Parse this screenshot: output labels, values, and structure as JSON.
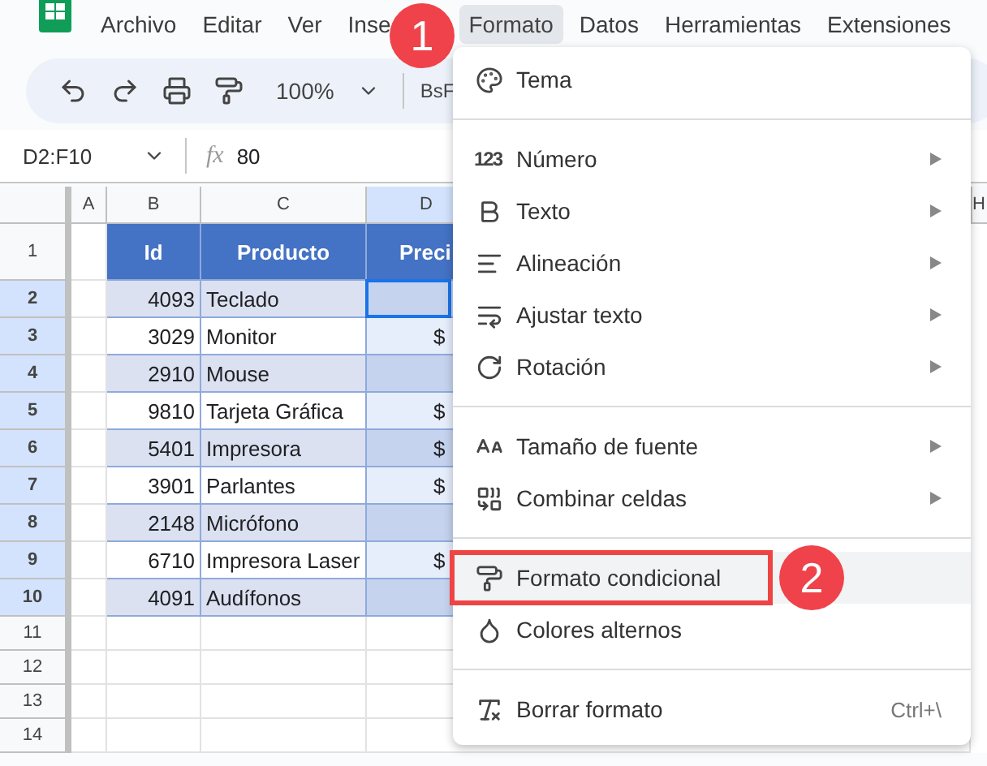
{
  "app_menu": [
    {
      "label": "Archivo",
      "selected": false
    },
    {
      "label": "Editar",
      "selected": false
    },
    {
      "label": "Ver",
      "selected": false
    },
    {
      "label": "Inse",
      "selected": false
    },
    {
      "label": "Formato",
      "selected": true
    },
    {
      "label": "Datos",
      "selected": false
    },
    {
      "label": "Herramientas",
      "selected": false
    },
    {
      "label": "Extensiones",
      "selected": false
    }
  ],
  "toolbar": {
    "zoom": "100%",
    "font": "BsF"
  },
  "formula_bar": {
    "range": "D2:F10",
    "function_label": "fx",
    "value": "80"
  },
  "grid": {
    "columns": [
      {
        "label": "A",
        "selected": false
      },
      {
        "label": "B",
        "selected": false
      },
      {
        "label": "C",
        "selected": false
      },
      {
        "label": "D",
        "selected": true
      },
      {
        "label": "H",
        "selected": false
      }
    ],
    "rows": [
      {
        "number": "1",
        "selected": false,
        "active": false,
        "kind": "header",
        "cells": [
          "Id",
          "Producto",
          "Preci"
        ]
      },
      {
        "number": "2",
        "selected": true,
        "active": true,
        "kind": "data",
        "cells": [
          "4093",
          "Teclado"
        ]
      },
      {
        "number": "3",
        "selected": true,
        "active": false,
        "kind": "data",
        "cells": [
          "3029",
          "Monitor",
          "$"
        ]
      },
      {
        "number": "4",
        "selected": true,
        "active": false,
        "kind": "data",
        "cells": [
          "2910",
          "Mouse"
        ]
      },
      {
        "number": "5",
        "selected": true,
        "active": false,
        "kind": "data",
        "cells": [
          "9810",
          "Tarjeta Gráfica",
          "$"
        ]
      },
      {
        "number": "6",
        "selected": true,
        "active": false,
        "kind": "data",
        "cells": [
          "5401",
          "Impresora",
          "$"
        ]
      },
      {
        "number": "7",
        "selected": true,
        "active": false,
        "kind": "data",
        "cells": [
          "3901",
          "Parlantes",
          "$"
        ]
      },
      {
        "number": "8",
        "selected": true,
        "active": false,
        "kind": "data",
        "cells": [
          "2148",
          "Micrófono"
        ]
      },
      {
        "number": "9",
        "selected": true,
        "active": false,
        "kind": "data",
        "cells": [
          "6710",
          "Impresora Laser",
          "$"
        ]
      },
      {
        "number": "10",
        "selected": true,
        "active": false,
        "kind": "data",
        "cells": [
          "4091",
          "Audífonos"
        ]
      },
      {
        "number": "11",
        "selected": false,
        "active": false,
        "kind": "empty"
      },
      {
        "number": "12",
        "selected": false,
        "active": false,
        "kind": "empty"
      },
      {
        "number": "13",
        "selected": false,
        "active": false,
        "kind": "empty"
      },
      {
        "number": "14",
        "selected": false,
        "active": false,
        "kind": "empty"
      }
    ]
  },
  "format_menu": {
    "items": [
      {
        "kind": "item",
        "label": "Tema",
        "submenu": false,
        "highlighted": false
      },
      {
        "kind": "divider"
      },
      {
        "kind": "item",
        "glyph": "123",
        "label": "Número",
        "submenu": true,
        "highlighted": false
      },
      {
        "kind": "item",
        "label": "Texto",
        "submenu": true,
        "highlighted": false
      },
      {
        "kind": "item",
        "label": "Alineación",
        "submenu": true,
        "highlighted": false
      },
      {
        "kind": "item",
        "label": "Ajustar texto",
        "submenu": true,
        "highlighted": false
      },
      {
        "kind": "item",
        "label": "Rotación",
        "submenu": true,
        "highlighted": false
      },
      {
        "kind": "divider"
      },
      {
        "kind": "item",
        "label": "Tamaño de fuente",
        "submenu": true,
        "highlighted": false
      },
      {
        "kind": "item",
        "label": "Combinar celdas",
        "submenu": true,
        "highlighted": false
      },
      {
        "kind": "divider"
      },
      {
        "kind": "item",
        "label": "Formato condicional",
        "submenu": false,
        "highlighted": true,
        "callout": "2"
      },
      {
        "kind": "item",
        "label": "Colores alternos",
        "submenu": false,
        "highlighted": false
      },
      {
        "kind": "divider"
      },
      {
        "kind": "item",
        "label": "Borrar formato",
        "submenu": false,
        "highlighted": false,
        "shortcut": "Ctrl+\\"
      }
    ]
  },
  "callout_menu": "1"
}
